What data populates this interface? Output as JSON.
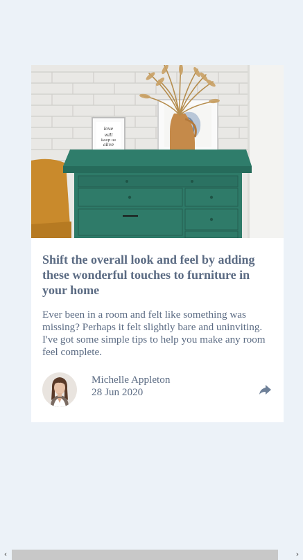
{
  "article": {
    "image_alt": "Green drawers with a vase of dried grass and framed art",
    "framed_art_text": "love will keep us alive",
    "title": "Shift the overall look and feel by adding these wonderful touches to furniture in your home",
    "excerpt": "Ever been in a room and felt like something was missing? Perhaps it felt slightly bare and uninviting. I've got some simple tips to help you make any room feel complete.",
    "author_name": "Michelle Appleton",
    "date": "28 Jun 2020",
    "share_icon": "share-icon"
  },
  "scrollbar": {
    "left_arrow": "‹",
    "right_arrow": "›"
  },
  "colors": {
    "page_background": "#ecf2f8",
    "card_background": "#ffffff",
    "text": "#5b6b83",
    "furniture_green": "#2e7a68"
  }
}
